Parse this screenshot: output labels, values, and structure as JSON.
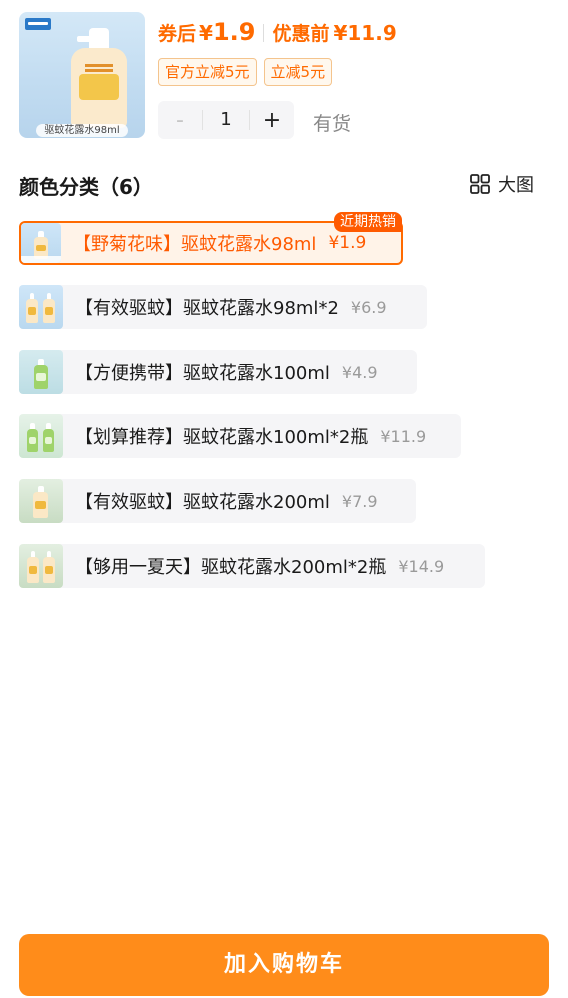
{
  "product": {
    "thumb_caption": "驱蚊花露水98ml"
  },
  "price": {
    "after_coupon_label": "券后",
    "currency": "¥",
    "after_coupon_value": "1.9",
    "before_discount_label": "优惠前",
    "before_discount_value": "¥11.9"
  },
  "coupons": [
    {
      "label": "官方立减5元"
    },
    {
      "label": "立减5元"
    }
  ],
  "quantity": {
    "minus": "-",
    "value": "1",
    "plus": "+"
  },
  "stock": "有货",
  "section": {
    "title": "颜色分类（6）",
    "big_view_label": "大图"
  },
  "options": [
    {
      "label": "【野菊花味】驱蚊花露水98ml",
      "price": "¥1.9",
      "selected": true,
      "badge": "近期热销"
    },
    {
      "label": "【有效驱蚊】驱蚊花露水98ml*2",
      "price": "¥6.9"
    },
    {
      "label": "【方便携带】驱蚊花露水100ml",
      "price": "¥4.9"
    },
    {
      "label": "【划算推荐】驱蚊花露水100ml*2瓶",
      "price": "¥11.9"
    },
    {
      "label": "【有效驱蚊】驱蚊花露水200ml",
      "price": "¥7.9"
    },
    {
      "label": "【够用一夏天】驱蚊花露水200ml*2瓶",
      "price": "¥14.9"
    }
  ],
  "cart_button": "加入购物车",
  "colors": {
    "accent": "#ff6a00",
    "cart_button": "#ff8c1a",
    "option_bg": "#f5f5f7"
  }
}
